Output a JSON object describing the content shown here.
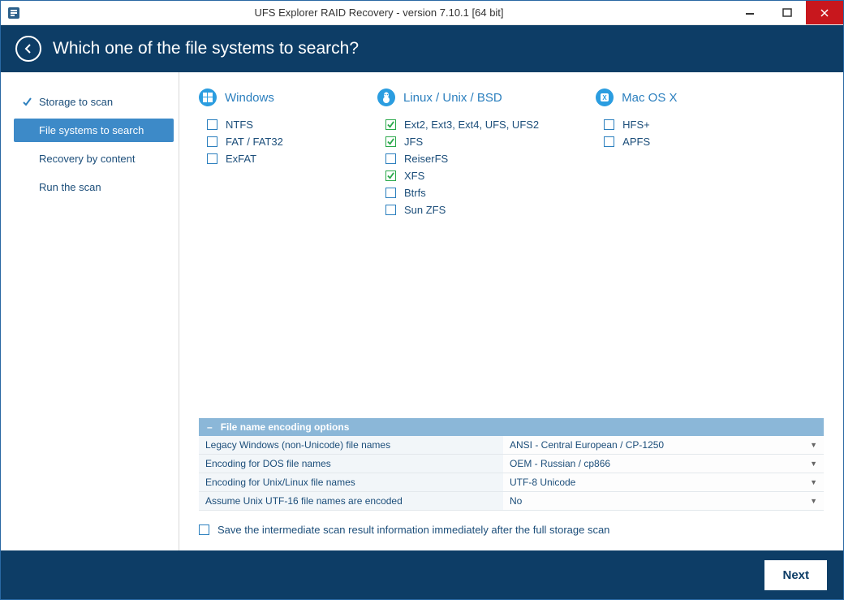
{
  "window": {
    "title": "UFS Explorer RAID Recovery - version 7.10.1 [64 bit]"
  },
  "header": {
    "title": "Which one of the file systems to search?"
  },
  "sidebar": {
    "steps": [
      {
        "label": "Storage to scan",
        "state": "done"
      },
      {
        "label": "File systems to search",
        "state": "active"
      },
      {
        "label": "Recovery by content",
        "state": "pending"
      },
      {
        "label": "Run the scan",
        "state": "pending"
      }
    ]
  },
  "fs_groups": [
    {
      "name": "Windows",
      "icon": "windows-icon",
      "items": [
        {
          "label": "NTFS",
          "checked": false
        },
        {
          "label": "FAT / FAT32",
          "checked": false
        },
        {
          "label": "ExFAT",
          "checked": false
        }
      ]
    },
    {
      "name": "Linux / Unix / BSD",
      "icon": "linux-icon",
      "items": [
        {
          "label": "Ext2, Ext3, Ext4, UFS, UFS2",
          "checked": true
        },
        {
          "label": "JFS",
          "checked": true
        },
        {
          "label": "ReiserFS",
          "checked": false
        },
        {
          "label": "XFS",
          "checked": true
        },
        {
          "label": "Btrfs",
          "checked": false
        },
        {
          "label": "Sun ZFS",
          "checked": false
        }
      ]
    },
    {
      "name": "Mac OS X",
      "icon": "macos-icon",
      "items": [
        {
          "label": "HFS+",
          "checked": false
        },
        {
          "label": "APFS",
          "checked": false
        }
      ]
    }
  ],
  "encoding": {
    "header": "File name encoding options",
    "rows": [
      {
        "label": "Legacy Windows (non-Unicode) file names",
        "value": "ANSI - Central European / CP-1250"
      },
      {
        "label": "Encoding for DOS file names",
        "value": "OEM - Russian / cp866"
      },
      {
        "label": "Encoding for Unix/Linux file names",
        "value": "UTF-8 Unicode"
      },
      {
        "label": "Assume Unix UTF-16 file names are encoded",
        "value": "No"
      }
    ]
  },
  "save_option": {
    "label": "Save the intermediate scan result information immediately after the full storage scan",
    "checked": false
  },
  "footer": {
    "next": "Next"
  }
}
